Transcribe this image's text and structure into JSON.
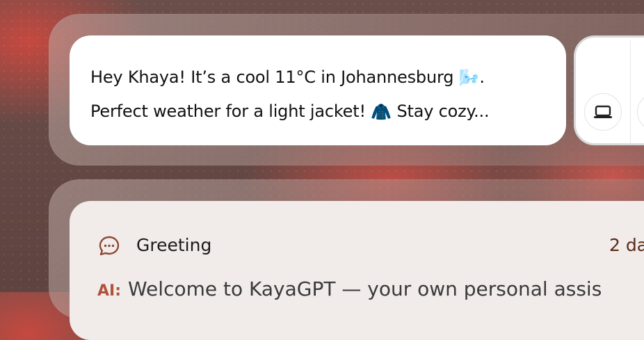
{
  "weather_message": {
    "line1": "Hey Khaya! It’s a cool 11°C in Johannesburg",
    "line1_emoji": "🌬️",
    "line1_end": ".",
    "line2": "Perfect weather for a light jacket!",
    "line2_emoji": "🧥",
    "line2_end": "Stay cozy..."
  },
  "actions": {
    "device_icon": "laptop-icon"
  },
  "history": {
    "icon": "chat-bubble-icon",
    "title": "Greeting",
    "time": "2 da",
    "preview_tag": "AI:",
    "preview_text": "Welcome to KayaGPT — your own personal assis"
  },
  "colors": {
    "accent_brown": "#5a2a16",
    "tag_red": "#b0523a"
  }
}
